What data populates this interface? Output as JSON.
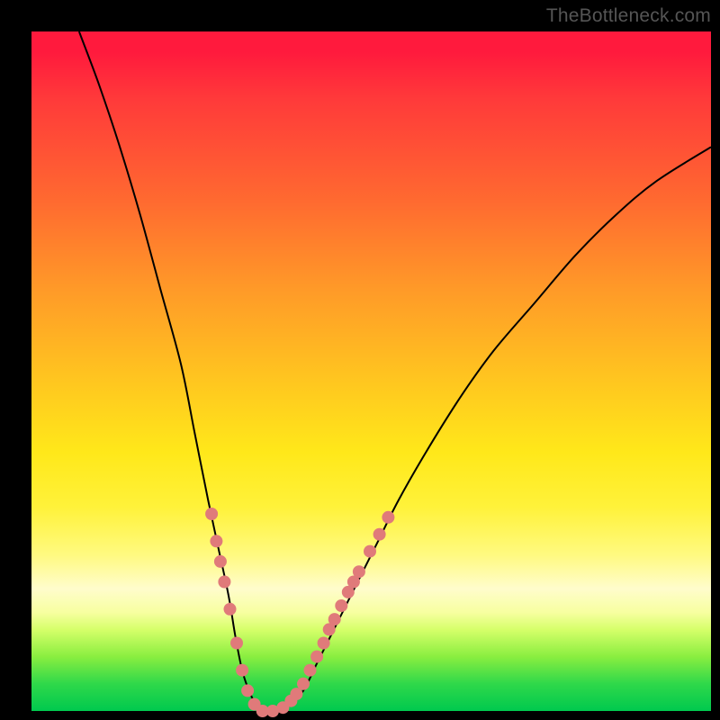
{
  "watermark": "TheBottleneck.com",
  "colors": {
    "background": "#000000",
    "gradient_top": "#ff1a3d",
    "gradient_mid": "#ffe81a",
    "gradient_bottom": "#00c94e",
    "curve": "#000000",
    "markers": "#e07a7a"
  },
  "chart_data": {
    "type": "line",
    "title": "",
    "xlabel": "",
    "ylabel": "",
    "xlim": [
      0,
      100
    ],
    "ylim": [
      0,
      100
    ],
    "series": [
      {
        "name": "bottleneck-curve",
        "x": [
          7,
          10,
          13,
          16,
          19,
          22,
          24,
          26,
          27.5,
          29,
          30,
          31,
          32,
          33,
          34,
          36,
          38,
          40,
          42,
          44,
          46,
          48,
          51,
          54,
          58,
          63,
          68,
          74,
          80,
          86,
          92,
          100
        ],
        "y": [
          100,
          92,
          83,
          73,
          62,
          51,
          41,
          31,
          24,
          17,
          11,
          6,
          3,
          1,
          0,
          0,
          1,
          3,
          7,
          11,
          15,
          19,
          25,
          31,
          38,
          46,
          53,
          60,
          67,
          73,
          78,
          83
        ]
      }
    ],
    "markers": {
      "name": "highlighted-points",
      "points": [
        {
          "x": 26.5,
          "y": 29
        },
        {
          "x": 27.2,
          "y": 25
        },
        {
          "x": 27.8,
          "y": 22
        },
        {
          "x": 28.4,
          "y": 19
        },
        {
          "x": 29.2,
          "y": 15
        },
        {
          "x": 30.2,
          "y": 10
        },
        {
          "x": 31.0,
          "y": 6
        },
        {
          "x": 31.8,
          "y": 3
        },
        {
          "x": 32.8,
          "y": 1
        },
        {
          "x": 34.0,
          "y": 0
        },
        {
          "x": 35.5,
          "y": 0
        },
        {
          "x": 37.0,
          "y": 0.5
        },
        {
          "x": 38.2,
          "y": 1.5
        },
        {
          "x": 39.0,
          "y": 2.5
        },
        {
          "x": 40.0,
          "y": 4
        },
        {
          "x": 41.0,
          "y": 6
        },
        {
          "x": 42.0,
          "y": 8
        },
        {
          "x": 43.0,
          "y": 10
        },
        {
          "x": 43.8,
          "y": 12
        },
        {
          "x": 44.6,
          "y": 13.5
        },
        {
          "x": 45.6,
          "y": 15.5
        },
        {
          "x": 46.6,
          "y": 17.5
        },
        {
          "x": 47.4,
          "y": 19
        },
        {
          "x": 48.2,
          "y": 20.5
        },
        {
          "x": 49.8,
          "y": 23.5
        },
        {
          "x": 51.2,
          "y": 26
        },
        {
          "x": 52.5,
          "y": 28.5
        }
      ]
    }
  }
}
